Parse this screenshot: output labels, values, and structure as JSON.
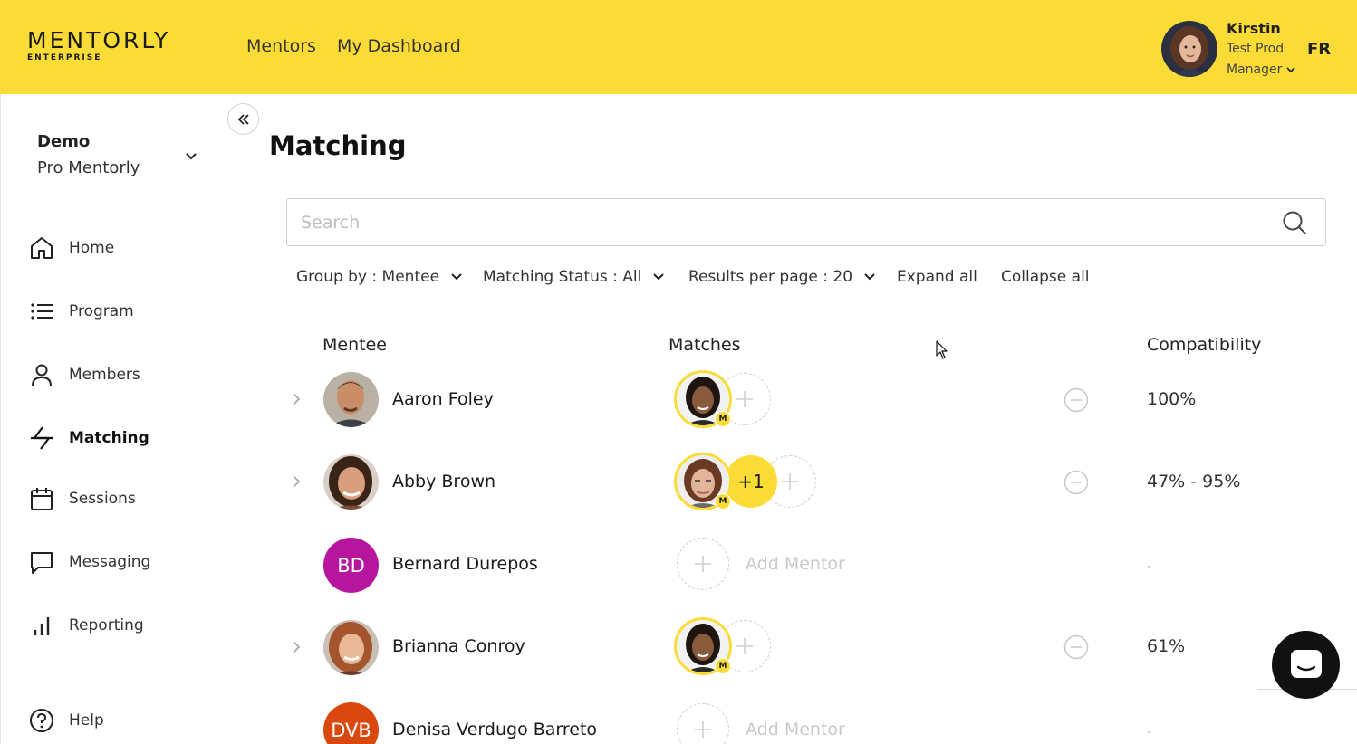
{
  "header": {
    "logo_main": "MENTORLY",
    "logo_sub": "ENTERPRISE",
    "nav": [
      {
        "label": "Mentors"
      },
      {
        "label": "My Dashboard"
      }
    ],
    "user": {
      "name": "Kirstin",
      "role_line1": "Test Prod",
      "role_line2": "Manager"
    },
    "language": "FR"
  },
  "sidebar": {
    "program": {
      "name": "Demo",
      "subtitle": "Pro Mentorly"
    },
    "items": [
      {
        "label": "Home",
        "icon": "home-icon"
      },
      {
        "label": "Program",
        "icon": "list-icon"
      },
      {
        "label": "Members",
        "icon": "person-icon"
      },
      {
        "label": "Matching",
        "icon": "matching-arrows-icon",
        "active": true
      },
      {
        "label": "Sessions",
        "icon": "calendar-icon"
      },
      {
        "label": "Messaging",
        "icon": "chat-bubble-icon"
      },
      {
        "label": "Reporting",
        "icon": "bar-chart-icon"
      },
      {
        "label": "Help",
        "icon": "help-icon"
      }
    ]
  },
  "main": {
    "title": "Matching",
    "search_placeholder": "Search",
    "filters": {
      "group_by": "Group by : Mentee",
      "status": "Matching Status : All",
      "per_page": "Results per page : 20",
      "expand": "Expand all",
      "collapse": "Collapse all"
    },
    "columns": {
      "mentee": "Mentee",
      "matches": "Matches",
      "compatibility": "Compatibility"
    },
    "rows": [
      {
        "name": "Aaron Foley",
        "compatibility": "100%",
        "extra": ""
      },
      {
        "name": "Abby Brown",
        "compatibility": "47% - 95%",
        "extra": "+1"
      },
      {
        "name": "Bernard Durepos",
        "initials": "BD",
        "compatibility": "-",
        "add_label": "Add Mentor"
      },
      {
        "name": "Brianna Conroy",
        "compatibility": "61%",
        "extra": ""
      },
      {
        "name": "Denisa Verdugo Barreto",
        "initials": "DVB",
        "compatibility": "-",
        "add_label": "Add Mentor"
      }
    ]
  },
  "colors": {
    "brand": "#fbdc36",
    "bd_avatar": "#b5169d",
    "dvb_avatar": "#d9480f"
  }
}
